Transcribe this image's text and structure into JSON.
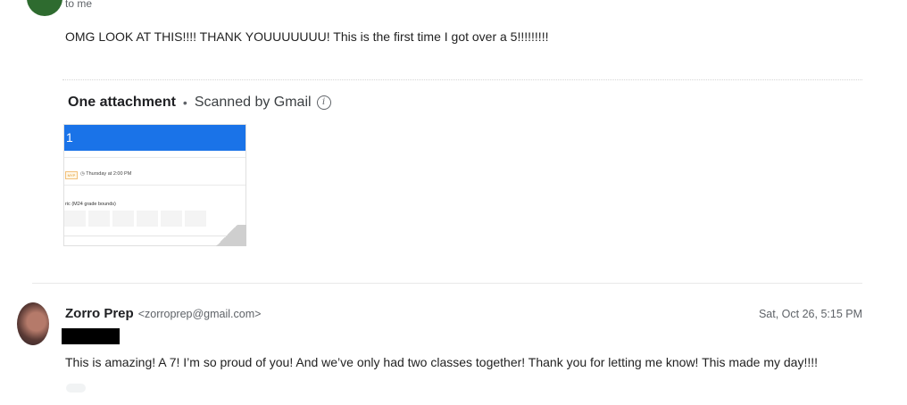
{
  "message1": {
    "recipient": "to me",
    "body": "OMG LOOK AT THIS!!!! THANK YOUUUUUUU! This is the first time I got over a 5!!!!!!!!!"
  },
  "attachments": {
    "title": "One attachment",
    "scanned": "Scanned by Gmail",
    "info_icon": "info-icon",
    "thumbnail": {
      "header": "1",
      "tag": "MYP",
      "time": "Thursday at 2:00 PM",
      "rubric": "ric (M24 grade bounds)"
    }
  },
  "message2": {
    "sender_name": "Zorro Prep",
    "sender_email": "<zorroprep@gmail.com>",
    "date": "Sat, Oct 26, 5:15 PM",
    "body": "This is amazing! A 7! I’m so proud of you! And we’ve only had two classes together! Thank you for letting me know! This made my day!!!!"
  },
  "colors": {
    "accent": "#1a73e8",
    "text": "#202124",
    "muted": "#5f6368"
  }
}
